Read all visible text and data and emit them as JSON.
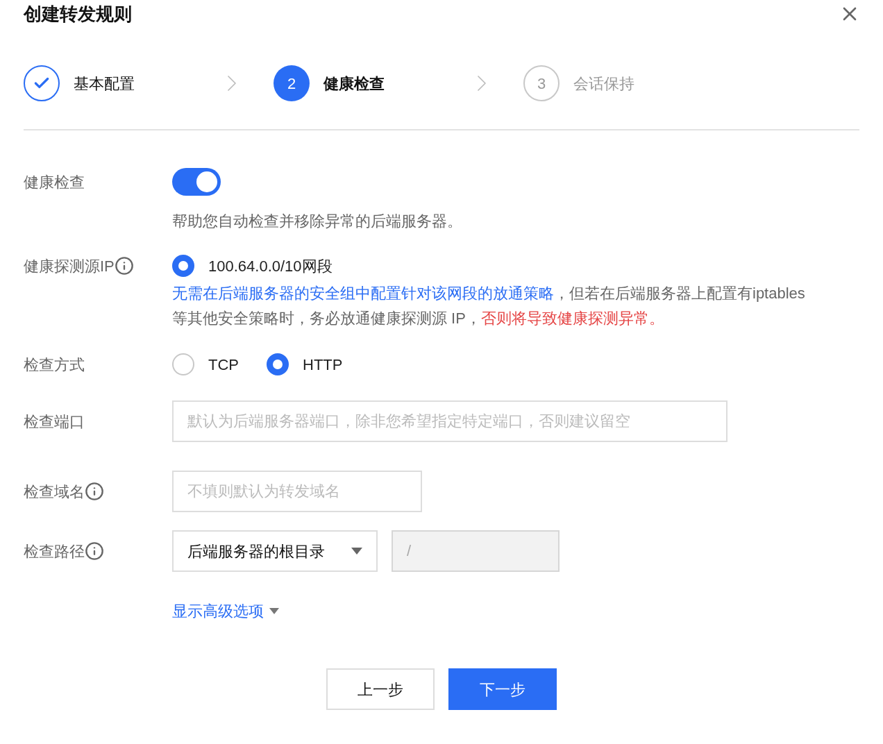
{
  "dialog": {
    "title": "创建转发规则"
  },
  "steps": [
    {
      "label": "基本配置",
      "completed": true,
      "selected": false
    },
    {
      "number": "2",
      "label": "健康检查",
      "completed": false,
      "selected": true
    },
    {
      "number": "3",
      "label": "会话保持",
      "completed": false,
      "selected": false
    }
  ],
  "health_check": {
    "label": "健康检查",
    "on": true,
    "hint": "帮助您自动检查并移除异常的后端服务器。"
  },
  "probe_source": {
    "label": "健康探测源IP",
    "options": [
      {
        "label": "100.64.0.0/10网段",
        "selected": true
      }
    ],
    "note": [
      {
        "kind": "link",
        "text": "无需在后端服务器的安全组中配置针对该网段的放通策略"
      },
      {
        "kind": "normal",
        "text": "，但若在后端服务器上配置有iptables等其他安全策略时，务必放通健康探测源 IP，"
      },
      {
        "kind": "danger",
        "text": "否则将导致健康探测异常。"
      }
    ]
  },
  "check_method": {
    "label": "检查方式",
    "options": [
      {
        "label": "TCP",
        "selected": false
      },
      {
        "label": "HTTP",
        "selected": true
      }
    ]
  },
  "check_port": {
    "label": "检查端口",
    "placeholder": "默认为后端服务器端口，除非您希望指定特定端口，否则建议留空"
  },
  "check_domain": {
    "label": "检查域名",
    "placeholder": "不填则默认为转发域名"
  },
  "check_path": {
    "label": "检查路径",
    "select_value": "后端服务器的根目录",
    "path_value": "/",
    "path_disabled": true
  },
  "advanced_link": "显示高级选项",
  "buttons": [
    {
      "label": "上一步",
      "kind": "secondary"
    },
    {
      "label": "下一步",
      "kind": "primary"
    }
  ]
}
